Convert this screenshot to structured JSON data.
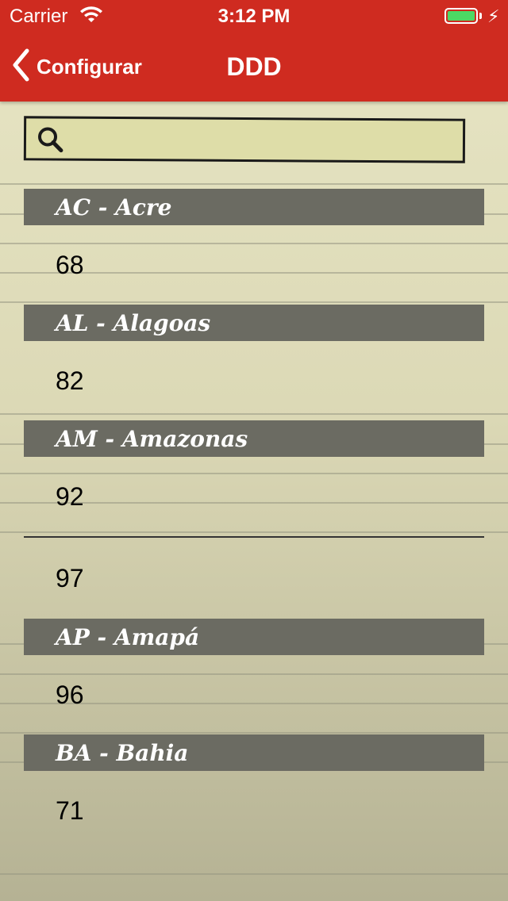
{
  "status_bar": {
    "carrier": "Carrier",
    "time": "3:12 PM",
    "battery_color": "#4cd964"
  },
  "nav": {
    "back_label": "Configurar",
    "title": "DDD",
    "color": "#cf2b20"
  },
  "search": {
    "placeholder": "",
    "value": ""
  },
  "sections": [
    {
      "header": "AC - Acre",
      "codes": [
        "68"
      ]
    },
    {
      "header": "AL - Alagoas",
      "codes": [
        "82"
      ]
    },
    {
      "header": "AM - Amazonas",
      "codes": [
        "92",
        "97"
      ]
    },
    {
      "header": "AP - Amapá",
      "codes": [
        "96"
      ]
    },
    {
      "header": "BA - Bahia",
      "codes": [
        "71"
      ]
    }
  ]
}
